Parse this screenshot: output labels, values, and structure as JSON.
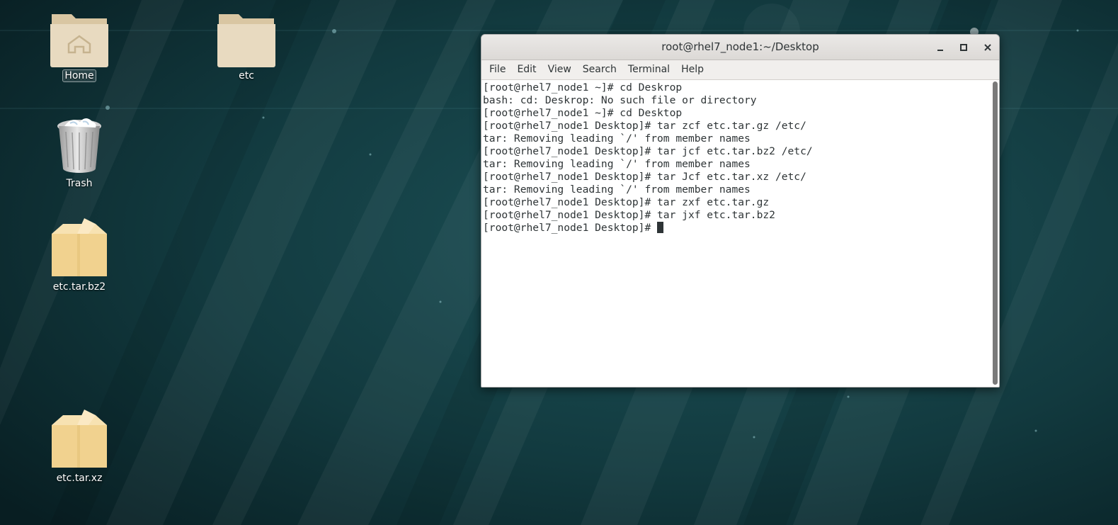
{
  "desktop": {
    "icons": [
      {
        "label": "Home",
        "type": "home-folder"
      },
      {
        "label": "etc",
        "type": "folder"
      },
      {
        "label": "Trash",
        "type": "trash"
      },
      {
        "label": "etc.tar.bz2",
        "type": "archive"
      },
      {
        "label": "etc.tar.xz",
        "type": "archive"
      }
    ]
  },
  "terminal": {
    "title": "root@rhel7_node1:~/Desktop",
    "window_buttons": [
      "minimize",
      "maximize",
      "close"
    ],
    "menu": [
      "File",
      "Edit",
      "View",
      "Search",
      "Terminal",
      "Help"
    ],
    "lines": [
      "[root@rhel7_node1 ~]# cd Deskrop",
      "bash: cd: Deskrop: No such file or directory",
      "[root@rhel7_node1 ~]# cd Desktop",
      "[root@rhel7_node1 Desktop]# tar zcf etc.tar.gz /etc/",
      "tar: Removing leading `/' from member names",
      "[root@rhel7_node1 Desktop]# tar jcf etc.tar.bz2 /etc/",
      "tar: Removing leading `/' from member names",
      "[root@rhel7_node1 Desktop]# tar Jcf etc.tar.xz /etc/",
      "tar: Removing leading `/' from member names",
      "[root@rhel7_node1 Desktop]# tar zxf etc.tar.gz",
      "[root@rhel7_node1 Desktop]# tar jxf etc.tar.bz2",
      "[root@rhel7_node1 Desktop]# "
    ]
  },
  "colors": {
    "wallpaper_base": "#0f2f33",
    "folder": "#e6d8bd",
    "archive": "#f1d28f",
    "terminal_text": "#2e3436"
  }
}
